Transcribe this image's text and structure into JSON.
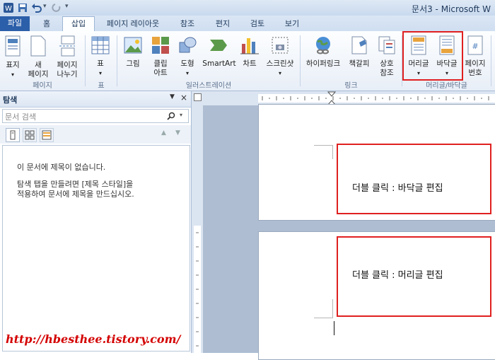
{
  "window": {
    "title": "문서3 - Microsoft W"
  },
  "tabs": [
    {
      "label": "파일"
    },
    {
      "label": "홈"
    },
    {
      "label": "삽입"
    },
    {
      "label": "페이지 레이아웃"
    },
    {
      "label": "참조"
    },
    {
      "label": "편지"
    },
    {
      "label": "검토"
    },
    {
      "label": "보기"
    }
  ],
  "ribbon": {
    "cover_label": "표지",
    "newpage_label": "새\n페이지",
    "pagebreak_label": "페이지\n나누기",
    "table_label": "표",
    "picture_label": "그림",
    "clipart_label": "클립\n아트",
    "shapes_label": "도형",
    "smartart_label": "SmartArt",
    "chart_label": "차트",
    "screenshot_label": "스크린샷",
    "hyperlink_label": "하이퍼링크",
    "bookmark_label": "책갈피",
    "crossref_label": "상호\n참조",
    "header_label": "머리글",
    "footer_label": "바닥글",
    "pagenum_label": "페이지\n번호",
    "groups": {
      "pages": "페이지",
      "tables": "표",
      "illustrations": "일러스트레이션",
      "links": "링크",
      "headerfooter": "머리글/바닥글"
    }
  },
  "navpane": {
    "title": "탐색",
    "search_placeholder": "문서 검색",
    "line1": "이 문서에 제목이 없습니다.",
    "line2": "탐색 탭을 만들려면 [제목 스타일]을",
    "line3": "적용하여 문서에 제목을 만드십시오."
  },
  "document": {
    "footer_hint": "더블 클릭 : 바닥글 편집",
    "header_hint": "더블 클릭 : 머리글 편집"
  },
  "watermark": "http://hbesthee.tistory.com/",
  "colors": {
    "highlight": "#e02020",
    "file_tab": "#2c5fa9",
    "watermark": "#d40000"
  }
}
